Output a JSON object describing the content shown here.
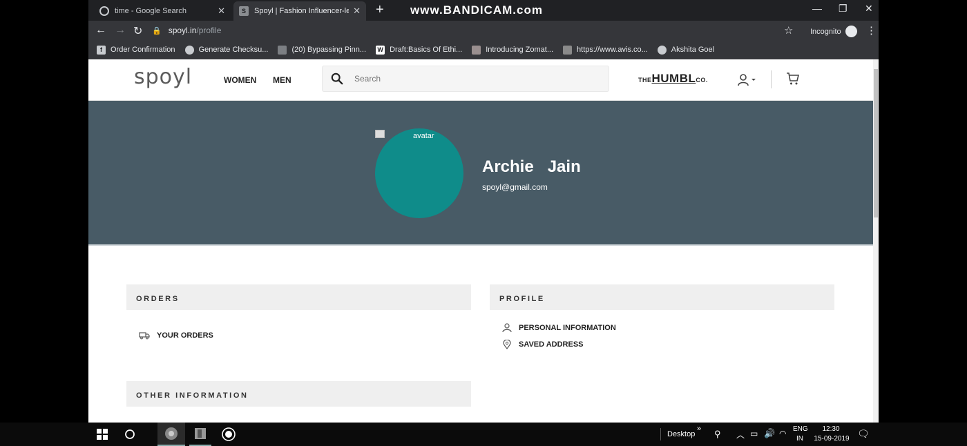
{
  "browser": {
    "tabs": [
      {
        "title": "time - Google Search",
        "favicon": "G"
      },
      {
        "title": "Spoyl | Fashion Influencer-led Or",
        "favicon": "S"
      }
    ],
    "watermark": "www.BANDICAM.com",
    "url_host": "spoyl.in",
    "url_path": "/profile",
    "incognito_label": "Incognito",
    "bookmarks": [
      {
        "label": "Order Confirmation",
        "favicon": "f"
      },
      {
        "label": "Generate Checksu...",
        "favicon": "globe"
      },
      {
        "label": "(20) Bypassing Pinn...",
        "favicon": "yt"
      },
      {
        "label": "Draft:Basics Of Ethi...",
        "favicon": "W"
      },
      {
        "label": "Introducing Zomat...",
        "favicon": "img"
      },
      {
        "label": "https://www.avis.co...",
        "favicon": "img"
      },
      {
        "label": "Akshita Goel",
        "favicon": "globe"
      }
    ]
  },
  "site": {
    "logo": "spoyl",
    "nav": {
      "women": "WOMEN",
      "men": "MEN"
    },
    "search_placeholder": "Search",
    "partner_logo_pre": "THE",
    "partner_logo_main": "HUMBL",
    "partner_logo_post": "CO."
  },
  "profile": {
    "avatar_alt": "avatar",
    "name": "Archie   Jain",
    "email": "spoyl@gmail.com",
    "avatar_color": "#0f8c8a",
    "banner_color": "#485b66"
  },
  "sections": {
    "orders": {
      "heading": "ORDERS",
      "items": [
        "YOUR ORDERS"
      ]
    },
    "profile": {
      "heading": "PROFILE",
      "items": [
        "PERSONAL INFORMATION",
        "SAVED ADDRESS"
      ]
    },
    "other": {
      "heading": "OTHER INFORMATION"
    }
  },
  "taskbar": {
    "desktop_label": "Desktop",
    "lang_top": "ENG",
    "lang_bottom": "IN",
    "time": "12:30",
    "date": "15-09-2019"
  }
}
